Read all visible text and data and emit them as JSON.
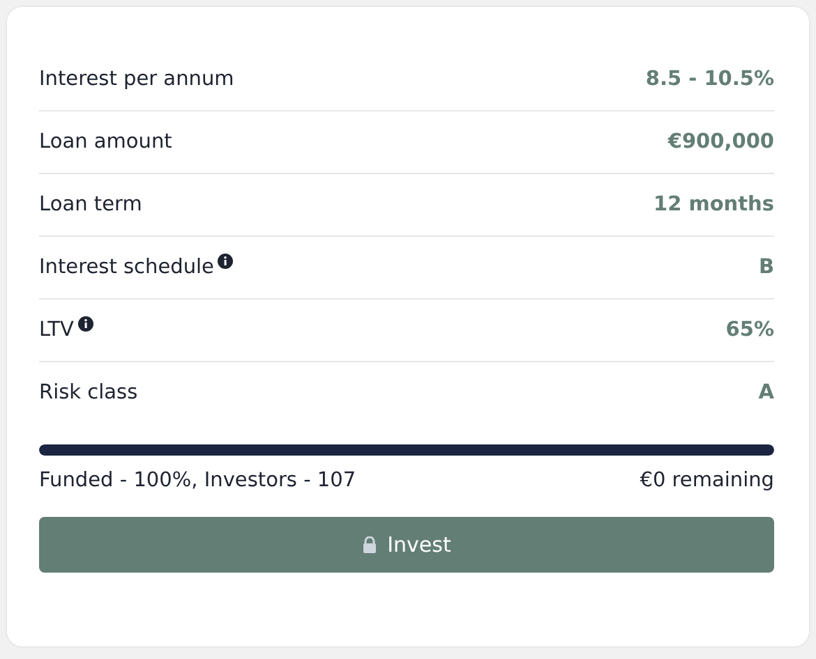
{
  "details": [
    {
      "label": "Interest per annum",
      "value": "8.5 - 10.5%",
      "info": false
    },
    {
      "label": "Loan amount",
      "value": "€900,000",
      "info": false
    },
    {
      "label": "Loan term",
      "value": "12 months",
      "info": false
    },
    {
      "label": "Interest schedule",
      "value": "B",
      "info": true
    },
    {
      "label": "LTV",
      "value": "65%",
      "info": true
    },
    {
      "label": "Risk class",
      "value": "A",
      "info": false
    }
  ],
  "funding": {
    "level": 1,
    "summary": "Funded - 100%, Investors - 107",
    "remaining": "€0 remaining"
  },
  "invest_button": {
    "label": "Invest",
    "locked": true
  }
}
